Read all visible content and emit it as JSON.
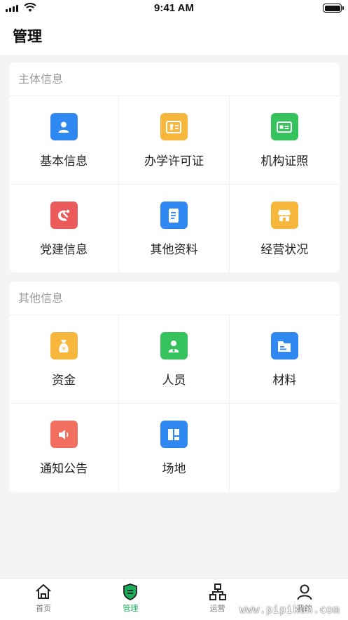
{
  "status": {
    "time": "9:41 AM"
  },
  "header": {
    "title": "管理"
  },
  "sections": [
    {
      "title": "主体信息",
      "items": [
        {
          "label": "基本信息",
          "icon": "person-icon",
          "color": "#2f87f2"
        },
        {
          "label": "办学许可证",
          "icon": "certificate-icon",
          "color": "#f6b73c"
        },
        {
          "label": "机构证照",
          "icon": "id-card-icon",
          "color": "#36c35e"
        },
        {
          "label": "党建信息",
          "icon": "party-emblem-icon",
          "color": "#ec5b5b"
        },
        {
          "label": "其他资料",
          "icon": "document-icon",
          "color": "#2f87f2"
        },
        {
          "label": "经营状况",
          "icon": "store-icon",
          "color": "#f6b73c"
        }
      ]
    },
    {
      "title": "其他信息",
      "items": [
        {
          "label": "资金",
          "icon": "money-bag-icon",
          "color": "#f6b73c"
        },
        {
          "label": "人员",
          "icon": "staff-icon",
          "color": "#36c35e"
        },
        {
          "label": "材料",
          "icon": "folder-icon",
          "color": "#2f87f2"
        },
        {
          "label": "通知公告",
          "icon": "speaker-icon",
          "color": "#f26e5f"
        },
        {
          "label": "场地",
          "icon": "layout-icon",
          "color": "#2f87f2"
        }
      ]
    }
  ],
  "tabs": [
    {
      "label": "首页",
      "icon": "home-icon"
    },
    {
      "label": "管理",
      "icon": "shield-icon",
      "active": true,
      "color": "#1aad5a"
    },
    {
      "label": "运营",
      "icon": "org-chart-icon"
    },
    {
      "label": "我的",
      "icon": "user-icon"
    }
  ],
  "watermark": "www.pipikun.com"
}
